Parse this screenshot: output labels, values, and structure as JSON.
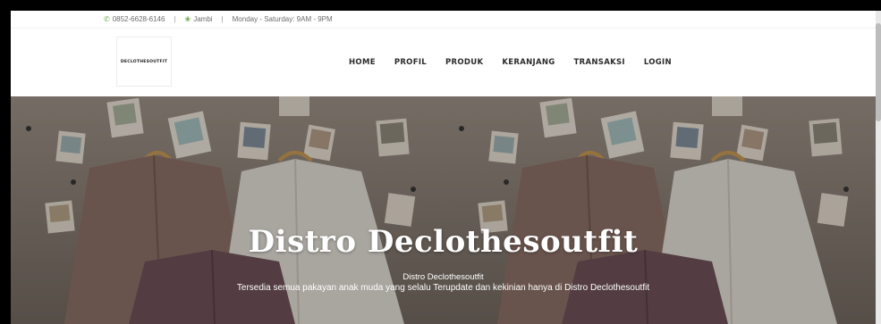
{
  "topbar": {
    "phone": "0852-6628-6146",
    "location": "Jambi",
    "hours": "Monday - Saturday: 9AM - 9PM",
    "phone_icon": "phone-icon",
    "location_icon": "location-icon"
  },
  "header": {
    "logo_text": "DECLOTHESOUTFIT",
    "nav": [
      "HOME",
      "PROFIL",
      "PRODUK",
      "KERANJANG",
      "TRANSAKSI",
      "LOGIN"
    ]
  },
  "hero": {
    "title": "Distro Declothesoutfit",
    "subtitle": "Distro Declothesoutfit",
    "description": "Tersedia semua pakayan anak muda yang selalu Terupdate dan kekinian hanya di Distro Declothesoutfit"
  },
  "colors": {
    "topbar_icon": "#6aa84f",
    "hero_bg": "#8e857b"
  }
}
